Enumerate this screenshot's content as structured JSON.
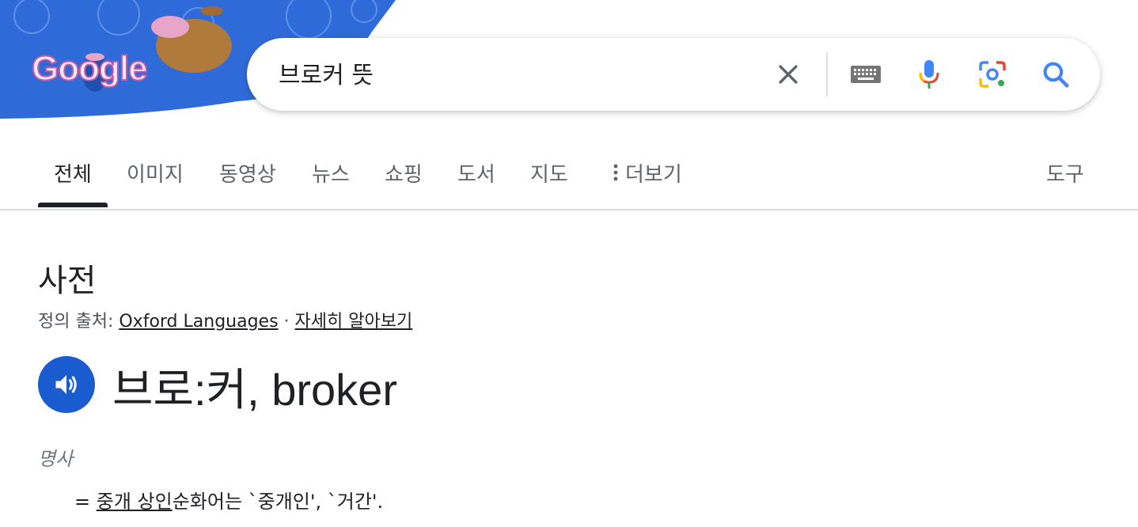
{
  "doodle": {
    "text": "Google"
  },
  "search": {
    "query": "브로커 뜻",
    "icons": [
      "clear-icon",
      "keyboard-icon",
      "mic-icon",
      "lens-icon",
      "search-icon"
    ]
  },
  "tabs": [
    {
      "label": "전체",
      "active": true
    },
    {
      "label": "이미지"
    },
    {
      "label": "동영상"
    },
    {
      "label": "뉴스"
    },
    {
      "label": "쇼핑"
    },
    {
      "label": "도서"
    },
    {
      "label": "지도"
    },
    {
      "label": "더보기"
    }
  ],
  "tools_label": "도구",
  "dictionary": {
    "title": "사전",
    "source_prefix": "정의 출처: ",
    "source_name": "Oxford Languages",
    "separator": " · ",
    "learn_more": "자세히 알아보기",
    "headword": "브로:커, broker",
    "part_of_speech": "명사",
    "definition_prefix": "= ",
    "definition_link": "중개 상인",
    "definition_rest": "순화어는 `중개인', `거간'."
  },
  "colors": {
    "accent": "#1a5bd0",
    "doodle_blue": "#2f6bd8"
  }
}
